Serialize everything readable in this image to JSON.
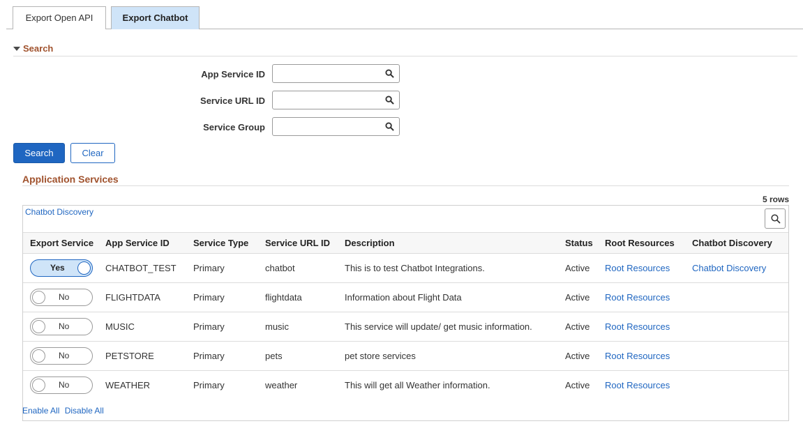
{
  "tabs": [
    {
      "label": "Export Open API",
      "active": false
    },
    {
      "label": "Export Chatbot",
      "active": true
    }
  ],
  "search_section": {
    "title": "Search",
    "fields": [
      {
        "label": "App Service ID",
        "value": ""
      },
      {
        "label": "Service URL ID",
        "value": ""
      },
      {
        "label": "Service Group",
        "value": ""
      }
    ],
    "search_button": "Search",
    "clear_button": "Clear"
  },
  "app_services": {
    "title": "Application Services",
    "rows_count": "5 rows",
    "discovery_link": "Chatbot Discovery",
    "columns": [
      "Export Service",
      "App Service ID",
      "Service Type",
      "Service URL ID",
      "Description",
      "Status",
      "Root Resources",
      "Chatbot Discovery"
    ],
    "rows": [
      {
        "export": "Yes",
        "export_on": true,
        "app_id": "CHATBOT_TEST",
        "type": "Primary",
        "url_id": "chatbot",
        "description": "This is to test Chatbot Integrations.",
        "status": "Active",
        "root": "Root Resources",
        "discovery": "Chatbot Discovery"
      },
      {
        "export": "No",
        "export_on": false,
        "app_id": "FLIGHTDATA",
        "type": "Primary",
        "url_id": "flightdata",
        "description": "Information about Flight Data",
        "status": "Active",
        "root": "Root Resources",
        "discovery": ""
      },
      {
        "export": "No",
        "export_on": false,
        "app_id": "MUSIC",
        "type": "Primary",
        "url_id": "music",
        "description": "This service will update/ get music information.",
        "status": "Active",
        "root": "Root Resources",
        "discovery": ""
      },
      {
        "export": "No",
        "export_on": false,
        "app_id": "PETSTORE",
        "type": "Primary",
        "url_id": "pets",
        "description": "pet store services",
        "status": "Active",
        "root": "Root Resources",
        "discovery": ""
      },
      {
        "export": "No",
        "export_on": false,
        "app_id": "WEATHER",
        "type": "Primary",
        "url_id": "weather",
        "description": "This will get all Weather information.",
        "status": "Active",
        "root": "Root Resources",
        "discovery": ""
      }
    ]
  },
  "footer": {
    "enable_all": "Enable All",
    "disable_all": "Disable All"
  },
  "colors": {
    "accent": "#1f66c1",
    "section_title": "#a0522d",
    "active_tab": "#cfe4f8"
  },
  "icons": [
    "search-icon",
    "collapse-caret-icon"
  ]
}
